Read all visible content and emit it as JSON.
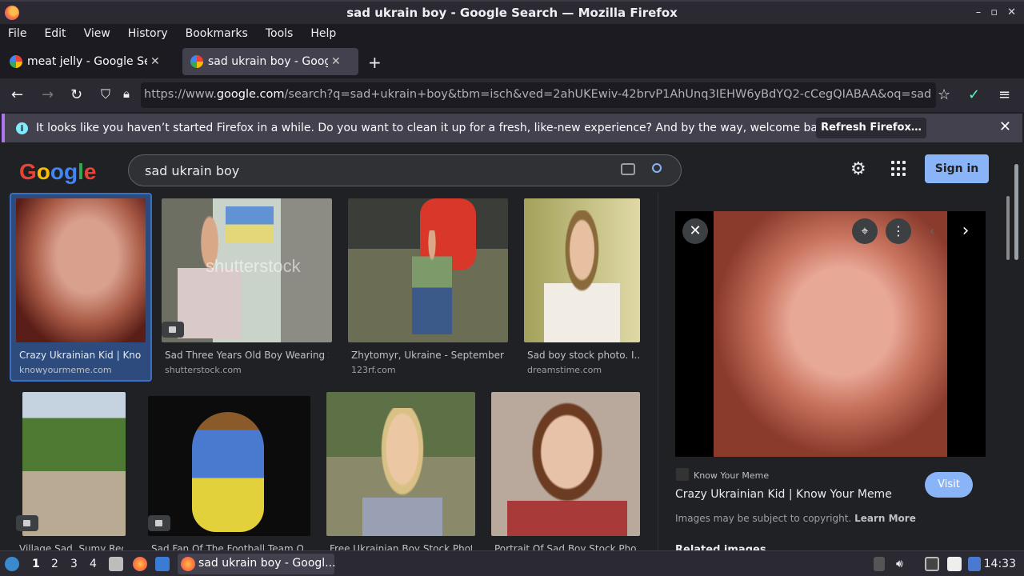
{
  "window": {
    "title": "sad ukrain boy - Google Search — Mozilla Firefox",
    "controls": [
      "–",
      "▫",
      "✕"
    ]
  },
  "menu": [
    "File",
    "Edit",
    "View",
    "History",
    "Bookmarks",
    "Tools",
    "Help"
  ],
  "tabs": [
    {
      "label": "meat jelly - Google Search",
      "active": false
    },
    {
      "label": "sad ukrain boy - Google Search",
      "active": true
    }
  ],
  "url": {
    "prefix": "https://www.",
    "domain": "google.com",
    "rest": "/search?q=sad+ukrain+boy&tbm=isch&ved=2ahUKEwiv-42brvP1AhUnq3IEHW6yBdYQ2-cCegQIABAA&oq=sad+ukrain+boy"
  },
  "notification": {
    "message": "It looks like you haven’t started Firefox in a while. Do you want to clean it up for a fresh, like-new experience? And by the way, welcome back!",
    "button": "Refresh Firefox…"
  },
  "search": {
    "query": "sad ukrain boy",
    "signin": "Sign in"
  },
  "results": [
    {
      "caption": "Crazy Ukrainian Kid | Kno...",
      "source": "knowyourmeme.com",
      "colors": [
        "#7a2a24",
        "#d18b77"
      ]
    },
    {
      "caption": "Sad Three Years Old Boy Wearing S...",
      "source": "shutterstock.com",
      "watermark": "shutterstock",
      "colors": [
        "#8c8f7a",
        "#d9c6b5"
      ]
    },
    {
      "caption": "Zhytomyr, Ukraine - September 0...",
      "source": "123rf.com",
      "colors": [
        "#4d5440",
        "#3b5a8a"
      ]
    },
    {
      "caption": "Sad boy stock photo. I...",
      "source": "dreamstime.com",
      "colors": [
        "#8c9a5b",
        "#d9c29a"
      ]
    },
    {
      "caption": "Village Sad, Sumy Regi...",
      "source": "",
      "colors": [
        "#5a7a3c",
        "#a89a7a"
      ]
    },
    {
      "caption": "Sad Fan Of The Football Team Of...",
      "source": "",
      "colors": [
        "#111111",
        "#4a7ad0"
      ]
    },
    {
      "caption": "Free Ukrainian Boy Stock Phot...",
      "source": "",
      "colors": [
        "#6d7a58",
        "#e0c39a"
      ]
    },
    {
      "caption": "Portrait Of Sad Boy Stock Phot...",
      "source": "",
      "colors": [
        "#b9a79a",
        "#8a5a3c"
      ]
    }
  ],
  "panel": {
    "source": "Know Your Meme",
    "title": "Crazy Ukrainian Kid | Know Your Meme",
    "visit": "Visit",
    "copyright": "Images may be subject to copyright.",
    "learn_more": "Learn More",
    "related": "Related images"
  },
  "taskbar": {
    "workspaces": [
      "1",
      "2",
      "3",
      "4"
    ],
    "task": "sad ukrain boy - Googl...",
    "clock": "14:33"
  }
}
